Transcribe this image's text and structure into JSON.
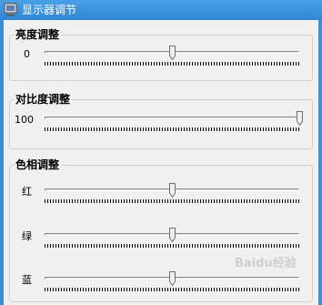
{
  "window": {
    "title": "显示器调节"
  },
  "brightness": {
    "legend": "亮度调整",
    "value_text": "0",
    "position": 0.5
  },
  "contrast": {
    "legend": "对比度调整",
    "value_text": "100",
    "position": 1.0
  },
  "hue": {
    "legend": "色相调整",
    "channels": [
      {
        "label": "红",
        "position": 0.5
      },
      {
        "label": "绿",
        "position": 0.5
      },
      {
        "label": "蓝",
        "position": 0.5
      }
    ]
  },
  "watermark": "Baidu经验"
}
